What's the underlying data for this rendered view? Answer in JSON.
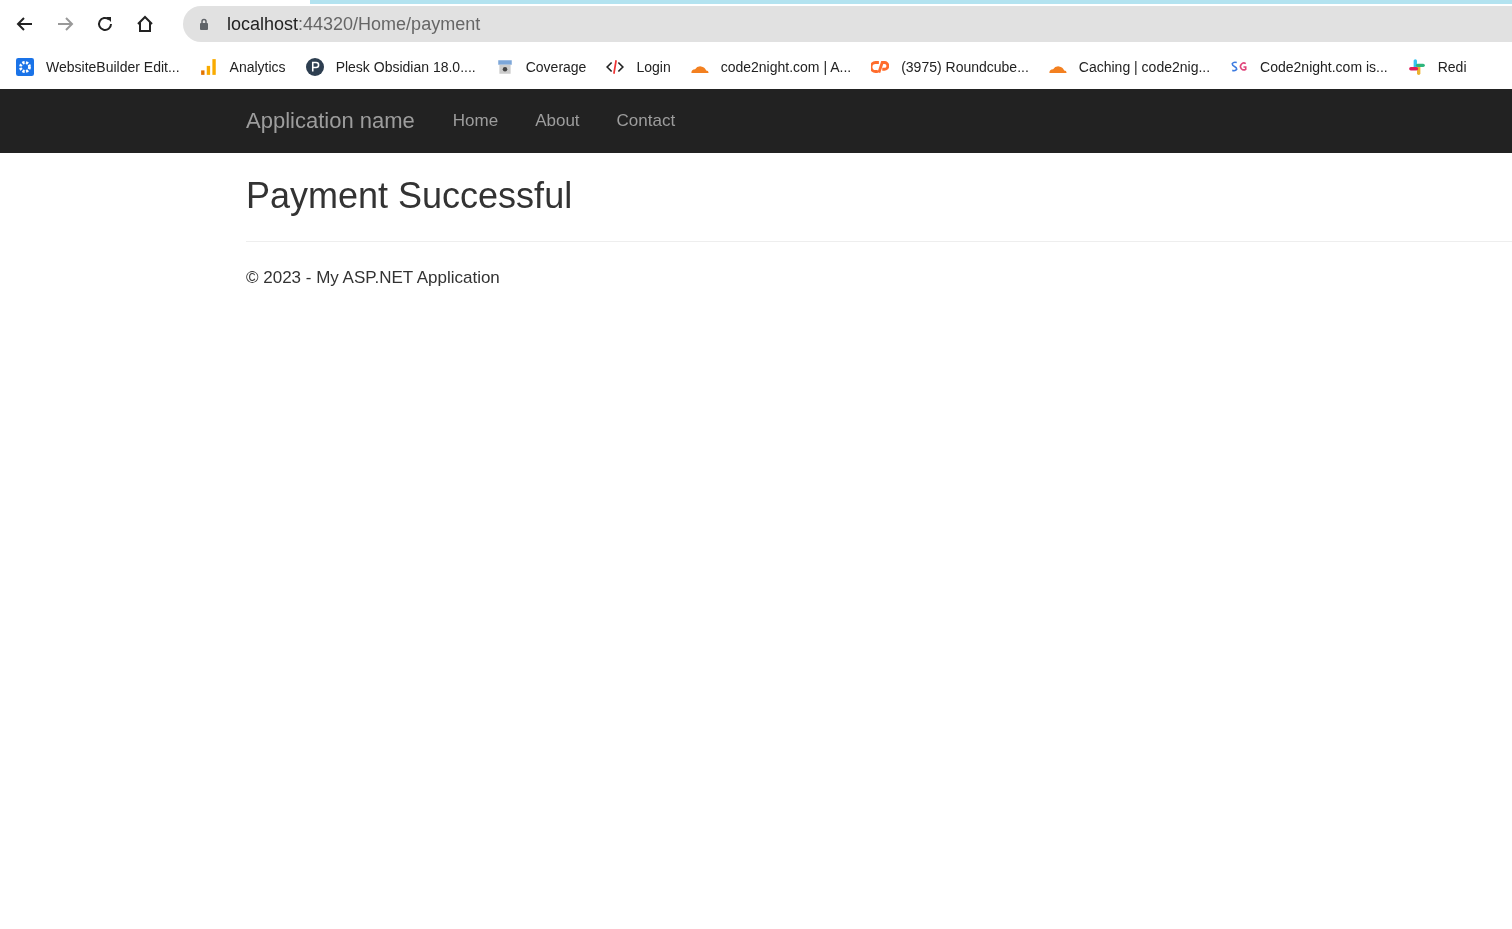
{
  "browser": {
    "url_host": "localhost",
    "url_path": ":44320/Home/payment"
  },
  "bookmarks": [
    {
      "kind": "gear",
      "label": "WebsiteBuilder Edit..."
    },
    {
      "kind": "bars",
      "label": "Analytics"
    },
    {
      "kind": "p-circle",
      "label": "Plesk Obsidian 18.0...."
    },
    {
      "kind": "shop",
      "label": "Coverage"
    },
    {
      "kind": "code",
      "label": "Login"
    },
    {
      "kind": "cloud",
      "label": "code2night.com | A..."
    },
    {
      "kind": "cp",
      "label": "(3975) Roundcube..."
    },
    {
      "kind": "cloud",
      "label": "Caching | code2nig..."
    },
    {
      "kind": "sg",
      "label": "Code2night.com is..."
    },
    {
      "kind": "slack",
      "label": "Redi"
    }
  ],
  "navbar": {
    "brand": "Application name",
    "links": [
      "Home",
      "About",
      "Contact"
    ]
  },
  "heading": "Payment Successful",
  "footer": "© 2023 - My ASP.NET Application"
}
